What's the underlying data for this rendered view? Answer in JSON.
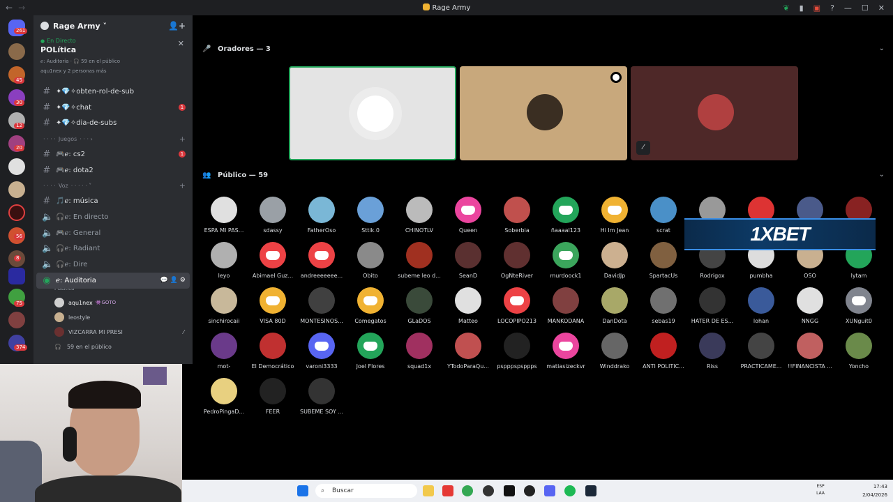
{
  "window": {
    "title": "Rage Army"
  },
  "servers": {
    "badge_top": "261",
    "badges": [
      "45",
      "30",
      "12",
      "20",
      "56",
      "8",
      "75",
      "374"
    ]
  },
  "guild": {
    "name": "Rage Army ˅"
  },
  "live": {
    "tag": "En Directo",
    "title": "POLítica",
    "meta": "ℯ: Auditoria · 🎧 59 en el público",
    "people": "aqu1nex y 2 personas más"
  },
  "channels": [
    {
      "name": "✦💎✧obten-rol-de-sub",
      "badge": ""
    },
    {
      "name": "✦💎✧chat",
      "badge": "1"
    },
    {
      "name": "✦💎✧dia-de-subs",
      "badge": ""
    }
  ],
  "cat_juegos": "Juegos",
  "game_channels": [
    {
      "name": "🎮ℯ: cs2",
      "badge": "1"
    },
    {
      "name": "🎮ℯ: dota2",
      "badge": ""
    }
  ],
  "cat_voz": "Voz",
  "voice_channels": [
    {
      "name": "🎵ℯ: música"
    },
    {
      "name": "🎧ℯ: En directo"
    },
    {
      "name": "🎮ℯ: General"
    },
    {
      "name": "🎧ℯ: Radiant"
    },
    {
      "name": "🎧ℯ: Dire"
    }
  ],
  "active_stage": {
    "name": "ℯ: Auditoria",
    "topic": "POLítica"
  },
  "stage_users": [
    {
      "name": "aqu1nex",
      "tag": "👾GOTO"
    },
    {
      "name": "leostyle",
      "tag": ""
    },
    {
      "name": "VIZCARRA MI PRESI",
      "tag": ""
    },
    {
      "name": "59 en el público",
      "tag": ""
    }
  ],
  "speakers": {
    "title": "Oradores — 3"
  },
  "audience_title": "Público — 59",
  "audience": [
    "ESPA MI PAS...",
    "sdassy",
    "FatherOso",
    "Sttik.0",
    "CHINOTLV",
    "Queen",
    "Soberbia",
    "ñaaaal123",
    "Hi Im Jean",
    "scrat",
    "",
    "",
    "",
    "",
    "leyo",
    "Abimael Guz...",
    "andreeeeeee...",
    "Obito",
    "subeme leo d...",
    "SeanD",
    "OgNteRiver",
    "murdoock1",
    "DavidJp",
    "SpartacUs",
    "Rodrigox",
    "pumbha",
    "OSO",
    "lytam",
    "sinchirocaii",
    "VISA 80D",
    "MONTESINOS...",
    "Comegatos",
    "GLaDOS",
    "Matteo",
    "LOCOPIPO213",
    "MANKODANA",
    "DanDota",
    "sebas19",
    "HATER DE ES...",
    "lohan",
    "NNGG",
    "XUNguit0",
    "mot-",
    "El Democrático",
    "varoni3333",
    "Joel Flores",
    "squad1x",
    "YTodoParaQu...",
    "pspppspsppps",
    "matiasizeckvr",
    "Winddrako",
    "ANTI POLITIC...",
    "Riss",
    "PRACTICAME...",
    "!!FINANCISTA ...",
    "Yoncho",
    "PedroPingaD...",
    "FEER",
    "SUBEME SOY ..."
  ],
  "ad": {
    "text": "1XBET"
  },
  "taskbar": {
    "search_placeholder": "Buscar",
    "lang": "ESP",
    "lang2": "LAA",
    "time": "17:43",
    "date": "2/04/2026"
  }
}
